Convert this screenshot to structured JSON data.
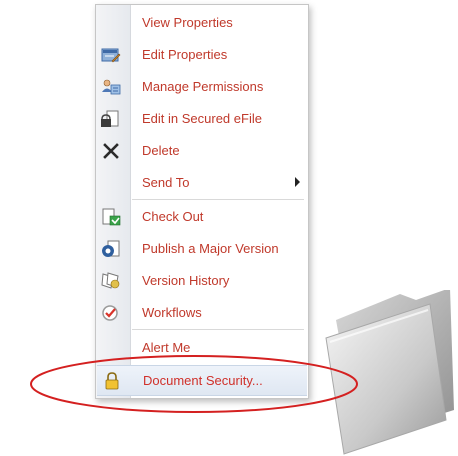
{
  "menu": {
    "items": [
      {
        "label": "View Properties",
        "icon": "none"
      },
      {
        "label": "Edit Properties",
        "icon": "edit-properties-icon"
      },
      {
        "label": "Manage Permissions",
        "icon": "manage-permissions-icon"
      },
      {
        "label": "Edit in Secured eFile",
        "icon": "secured-efile-icon"
      },
      {
        "label": "Delete",
        "icon": "delete-x-icon"
      },
      {
        "label": "Send To",
        "icon": "none",
        "submenu": true
      },
      {
        "label": "Check Out",
        "icon": "check-out-icon"
      },
      {
        "label": "Publish a Major Version",
        "icon": "publish-major-version-icon"
      },
      {
        "label": "Version History",
        "icon": "version-history-icon"
      },
      {
        "label": "Workflows",
        "icon": "workflows-icon"
      },
      {
        "label": "Alert Me",
        "icon": "none"
      },
      {
        "label": "Document Security...",
        "icon": "padlock-icon",
        "highlighted": true
      }
    ]
  },
  "colors": {
    "menu_text": "#c0392b",
    "highlight_ellipse": "#d42020"
  }
}
